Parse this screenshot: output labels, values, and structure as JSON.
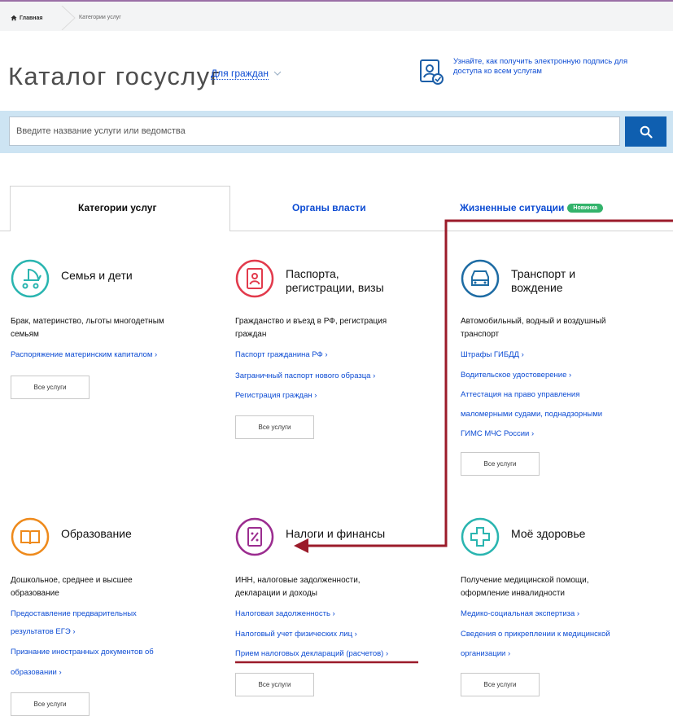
{
  "breadcrumb": {
    "home": "Главная",
    "current": "Категории услуг"
  },
  "header": {
    "title": "Каталог госуслуг",
    "audience": "Для граждан",
    "signature_hint": "Узнайте, как получить электронную подпись для доступа ко всем услугам"
  },
  "search": {
    "placeholder": "Введите название услуги или ведомства"
  },
  "tabs": [
    {
      "label": "Категории услуг",
      "active": true
    },
    {
      "label": "Органы власти"
    },
    {
      "label": "Жизненные ситуации",
      "badge": "Новинка"
    }
  ],
  "categories": [
    {
      "title_lines": [
        "Семья и дети"
      ],
      "desc_lines": [
        "Брак, материнство, льготы многодетным",
        "семьям"
      ],
      "links": [
        "Распоряжение материнским капиталом ›"
      ],
      "all": "Все услуги",
      "icon": "stroller-icon",
      "color": "#2ab5b0"
    },
    {
      "title_lines": [
        "Паспорта,",
        "регистрации, визы"
      ],
      "desc_lines": [
        "Гражданство и въезд в РФ, регистрация",
        "граждан"
      ],
      "links": [
        "Паспорт гражданина РФ ›",
        "Заграничный паспорт нового образца ›",
        "Регистрация граждан ›"
      ],
      "all": "Все услуги",
      "icon": "passport-icon",
      "color": "#e23a4c"
    },
    {
      "title_lines": [
        "Транспорт и",
        "вождение"
      ],
      "desc_lines": [
        "Автомобильный, водный и воздушный",
        "транспорт"
      ],
      "links": [
        "Штрафы ГИБДД ›",
        "Водительское удостоверение ›",
        "Аттестация на право управления",
        "маломерными судами, поднадзорными",
        "ГИМС МЧС России ›"
      ],
      "all": "Все услуги",
      "icon": "car-icon",
      "color": "#1e6ca4"
    },
    {
      "title_lines": [
        "Образование"
      ],
      "desc_lines": [
        "Дошкольное, среднее и высшее",
        "образование"
      ],
      "links": [
        "Предоставление предварительных",
        "результатов ЕГЭ ›",
        "Признание иностранных документов об",
        "образовании ›"
      ],
      "all": "Все услуги",
      "icon": "book-icon",
      "color": "#ee8a1c"
    },
    {
      "title_lines": [
        "Налоги и финансы"
      ],
      "desc_lines": [
        "ИНН, налоговые задолженности,",
        "декларации и доходы"
      ],
      "links": [
        "Налоговая задолженность ›",
        "Налоговый учет физических лиц ›",
        "Прием налоговых деклараций (расчетов) ›"
      ],
      "all": "Все услуги",
      "icon": "tax-document-icon",
      "color": "#9b2c8f"
    },
    {
      "title_lines": [
        "Моё здоровье"
      ],
      "desc_lines": [
        "Получение медицинской помощи,",
        "оформление инвалидности"
      ],
      "links": [
        "Медико-социальная экспертиза ›",
        "Сведения о прикреплении к медицинской",
        "организации ›"
      ],
      "all": "Все услуги",
      "icon": "medical-cross-icon",
      "color": "#2ab5b0"
    }
  ],
  "annotation": {
    "color": "#9b1b2a"
  }
}
